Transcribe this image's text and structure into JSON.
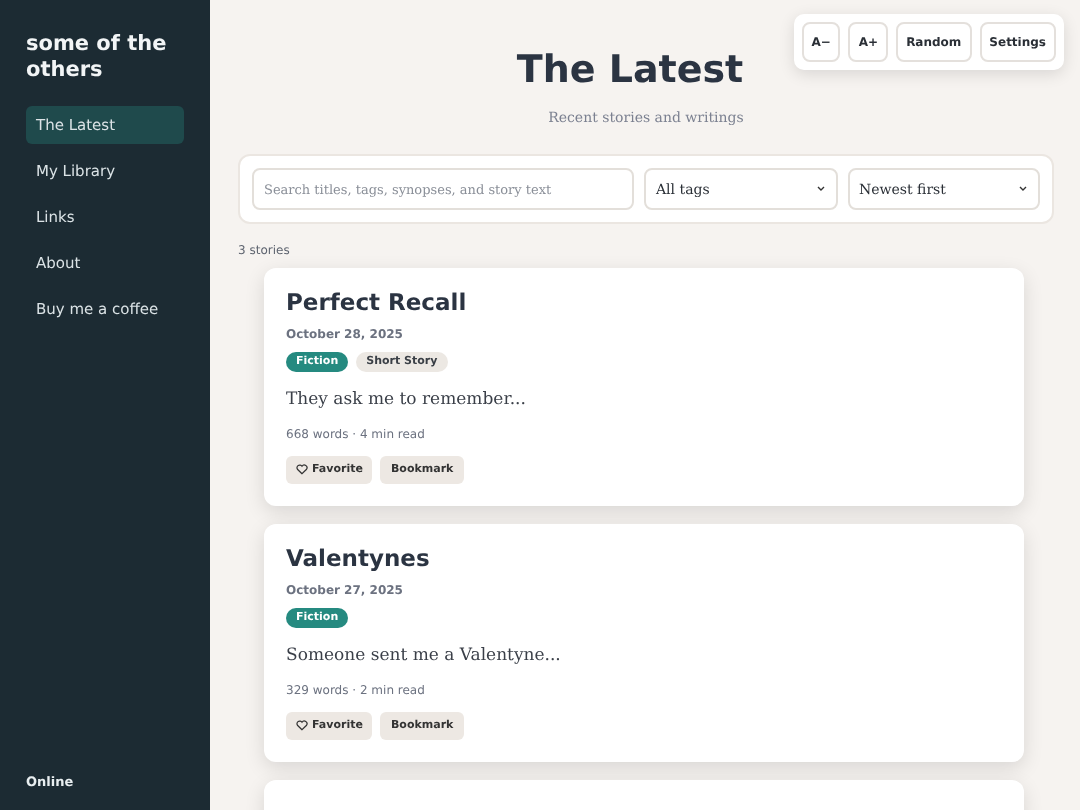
{
  "sidebar": {
    "title": "some of the others",
    "items": [
      {
        "label": "The Latest",
        "selected": true
      },
      {
        "label": "My Library",
        "selected": false
      },
      {
        "label": "Links",
        "selected": false
      },
      {
        "label": "About",
        "selected": false
      },
      {
        "label": "Buy me a coffee",
        "selected": false
      }
    ],
    "status": "Online"
  },
  "toolbar": [
    "A−",
    "A+",
    "Random",
    "Settings"
  ],
  "header": {
    "title": "The Latest",
    "subtitle": "Recent stories and writings"
  },
  "filters": {
    "search": {
      "placeholder": "Search titles, tags, synopses, and story text"
    },
    "tag_select": "All tags",
    "sort_select": "Newest first"
  },
  "count": "3 stories",
  "stories": [
    {
      "title": "Perfect Recall",
      "date": "October 28, 2025",
      "tags": [
        {
          "label": "Fiction",
          "kind": "genre"
        },
        {
          "label": "Short Story",
          "kind": "form"
        }
      ],
      "excerpt": "They ask me to remember...",
      "meta": "668 words · 4 min read",
      "buttons": [
        "Favorite",
        "Bookmark"
      ]
    },
    {
      "title": "Valentynes",
      "date": "October 27, 2025",
      "tags": [
        {
          "label": "Fiction",
          "kind": "genre"
        }
      ],
      "excerpt": "Someone sent me a Valentyne...",
      "meta": "329 words · 2 min read",
      "buttons": [
        "Favorite",
        "Bookmark"
      ]
    }
  ]
}
